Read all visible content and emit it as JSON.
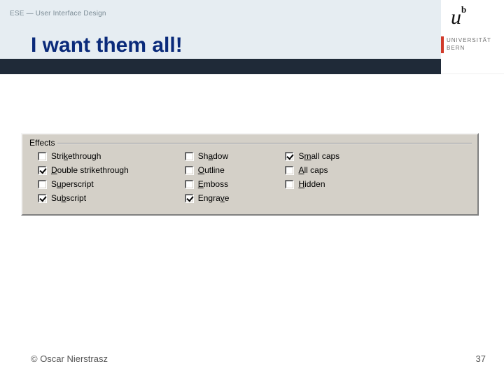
{
  "header": {
    "breadcrumb": "ESE — User Interface Design",
    "title": "I want them all!"
  },
  "logo": {
    "u": "u",
    "b": "b",
    "line1": "UNIVERSITÄT",
    "line2": "BERN"
  },
  "effects": {
    "group_label": "Effects",
    "col1": [
      {
        "label": "Strikethrough",
        "accel": "K",
        "checked": false
      },
      {
        "label": "Double strikethrough",
        "accel": "D",
        "checked": true
      },
      {
        "label": "Superscript",
        "accel": "u",
        "checked": false
      },
      {
        "label": "Subscript",
        "accel": "b",
        "checked": true
      }
    ],
    "col2": [
      {
        "label": "Shadow",
        "accel": "a",
        "checked": false
      },
      {
        "label": "Outline",
        "accel": "O",
        "checked": false
      },
      {
        "label": "Emboss",
        "accel": "E",
        "checked": false
      },
      {
        "label": "Engrave",
        "accel": "v",
        "checked": true
      }
    ],
    "col3": [
      {
        "label": "Small caps",
        "accel": "m",
        "checked": true
      },
      {
        "label": "All caps",
        "accel": "A",
        "checked": false
      },
      {
        "label": "Hidden",
        "accel": "H",
        "checked": false
      }
    ]
  },
  "footer": {
    "copyright": "© Oscar Nierstrasz",
    "page": "37"
  }
}
